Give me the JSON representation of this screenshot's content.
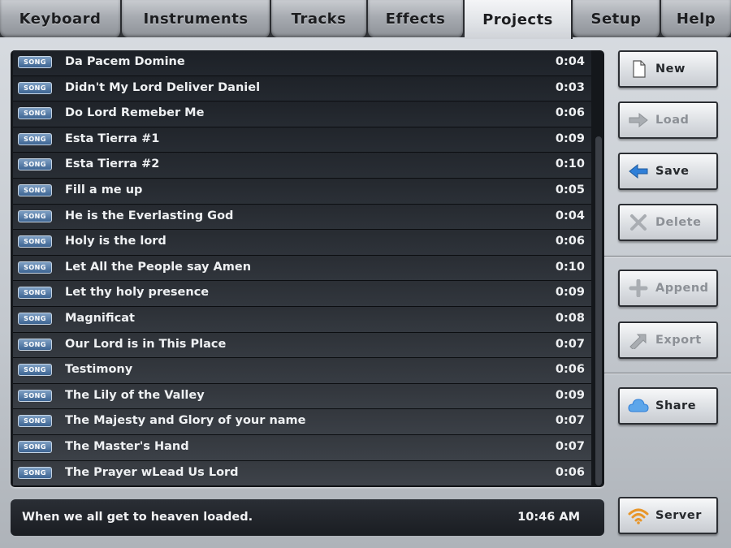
{
  "tabs": {
    "keyboard": "Keyboard",
    "instruments": "Instruments",
    "tracks": "Tracks",
    "effects": "Effects",
    "projects": "Projects",
    "setup": "Setup",
    "help": "Help"
  },
  "badge_label": "SONG",
  "songs": [
    {
      "name": "Da Pacem Domine",
      "duration": "0:04"
    },
    {
      "name": "Didn't My Lord Deliver Daniel",
      "duration": "0:03"
    },
    {
      "name": "Do Lord Remeber Me",
      "duration": "0:06"
    },
    {
      "name": "Esta Tierra #1",
      "duration": "0:09"
    },
    {
      "name": "Esta Tierra #2",
      "duration": "0:10"
    },
    {
      "name": "Fill a me up",
      "duration": "0:05"
    },
    {
      "name": "He is the Everlasting God",
      "duration": "0:04"
    },
    {
      "name": "Holy is the lord",
      "duration": "0:06"
    },
    {
      "name": "Let All the People say Amen",
      "duration": "0:10"
    },
    {
      "name": "Let thy holy presence",
      "duration": "0:09"
    },
    {
      "name": "Magnificat",
      "duration": "0:08"
    },
    {
      "name": "Our Lord is in This Place",
      "duration": "0:07"
    },
    {
      "name": "Testimony",
      "duration": "0:06"
    },
    {
      "name": "The Lily of the Valley",
      "duration": "0:09"
    },
    {
      "name": "The Majesty and Glory of your name",
      "duration": "0:07"
    },
    {
      "name": "The Master's Hand",
      "duration": "0:07"
    },
    {
      "name": "The Prayer wLead Us Lord",
      "duration": "0:06"
    }
  ],
  "status": {
    "message": "When we all get to heaven loaded.",
    "time": "10:46 AM"
  },
  "buttons": {
    "new": "New",
    "load": "Load",
    "save": "Save",
    "delete": "Delete",
    "append": "Append",
    "export": "Export",
    "share": "Share",
    "server": "Server"
  },
  "colors": {
    "accent_blue": "#2f7fd8",
    "server_orange": "#e8962a",
    "list_row_top": "#1d2127",
    "list_row_bottom": "#3a414b"
  },
  "icons": {
    "new": "document-icon",
    "load": "arrow-right-icon",
    "save": "arrow-left-icon",
    "delete": "x-icon",
    "append": "plus-icon",
    "export": "export-arrow-icon",
    "share": "cloud-icon",
    "server": "wifi-icon"
  }
}
